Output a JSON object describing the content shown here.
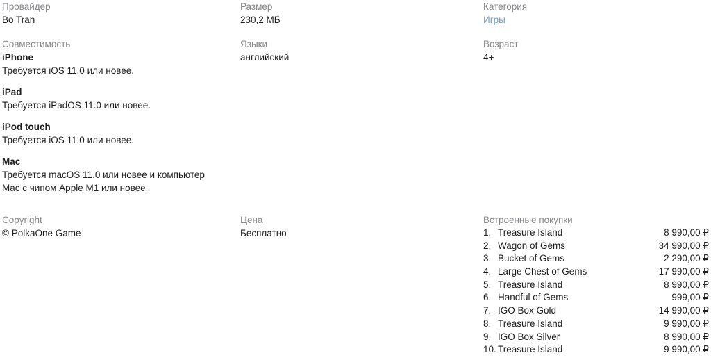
{
  "left_column": {
    "provider": {
      "label": "Провайдер",
      "value": "Bo Tran"
    },
    "compatibility": {
      "label": "Совместимость",
      "devices": [
        {
          "name": "iPhone",
          "requirement": "Требуется iOS 11.0 или новее."
        },
        {
          "name": "iPad",
          "requirement": "Требуется iPadOS 11.0 или новее."
        },
        {
          "name": "iPod touch",
          "requirement": "Требуется iOS 11.0 или новее."
        },
        {
          "name": "Mac",
          "requirement": "Требуется macOS 11.0 или новее и компьютер Mac с чипом Apple M1 или новее."
        }
      ]
    },
    "copyright": {
      "label": "Copyright",
      "value": "© PolkaOne Game"
    }
  },
  "middle_column": {
    "size": {
      "label": "Размер",
      "value": "230,2 МБ"
    },
    "languages": {
      "label": "Языки",
      "value": "английский"
    },
    "price": {
      "label": "Цена",
      "value": "Бесплатно"
    }
  },
  "right_column": {
    "category": {
      "label": "Категория",
      "value": "Игры"
    },
    "age_rating": {
      "label": "Возраст",
      "value": "4+"
    },
    "in_app_purchases": {
      "label": "Встроенные покупки",
      "items": [
        {
          "index": "1.",
          "name": "Treasure Island",
          "price": "8 990,00 ₽"
        },
        {
          "index": "2.",
          "name": "Wagon of Gems",
          "price": "34 990,00 ₽"
        },
        {
          "index": "3.",
          "name": "Bucket of Gems",
          "price": "2 290,00 ₽"
        },
        {
          "index": "4.",
          "name": "Large Chest of Gems",
          "price": "17 990,00 ₽"
        },
        {
          "index": "5.",
          "name": "Treasure Island",
          "price": "8 990,00 ₽"
        },
        {
          "index": "6.",
          "name": "Handful of Gems",
          "price": "999,00 ₽"
        },
        {
          "index": "7.",
          "name": "IGO Box Gold",
          "price": "14 990,00 ₽"
        },
        {
          "index": "8.",
          "name": "Treasure Island",
          "price": "9 990,00 ₽"
        },
        {
          "index": "9.",
          "name": "IGO Box Silver",
          "price": "8 990,00 ₽"
        },
        {
          "index": "10.",
          "name": "Treasure Island",
          "price": "9 990,00 ₽"
        }
      ]
    }
  },
  "colors": {
    "background": "#ffffff",
    "label_text": "#86868b",
    "value_text": "#1d1d1f",
    "link": "#6f9dc7"
  }
}
